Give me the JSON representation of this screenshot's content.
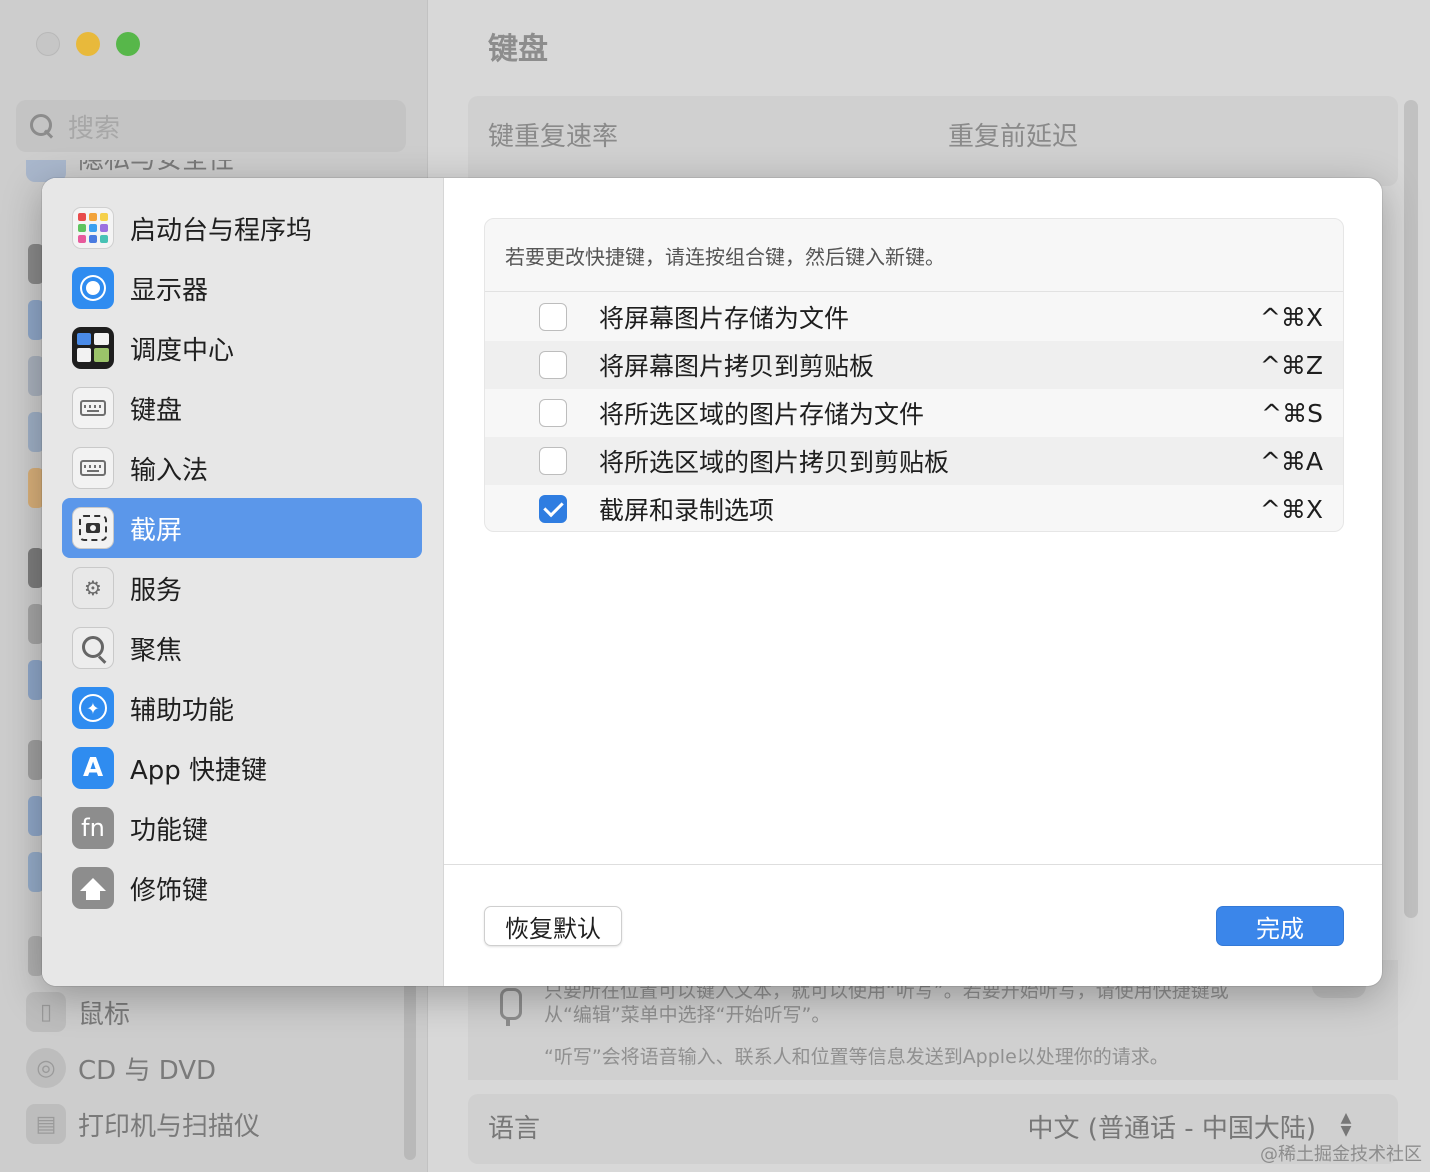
{
  "background": {
    "search_placeholder": "搜索",
    "main_title": "键盘",
    "repeat_rate_label": "键重复速率",
    "repeat_delay_label": "重复前延迟",
    "partial_sidebar_text": "隐私与安全性",
    "sidebar_items": [
      {
        "label": "鼠标",
        "icon": "mouse-icon"
      },
      {
        "label": "CD 与 DVD",
        "icon": "disc-icon"
      },
      {
        "label": "打印机与扫描仪",
        "icon": "printer-icon"
      }
    ],
    "dictation_text_line1": "只要所在位置可以键入文本，就可以使用“听写”。若要开始听写，请使用快捷键或",
    "dictation_text_line2": "从“编辑”菜单中选择“开始听写”。",
    "dictation_privacy": "“听写”会将语音输入、联系人和位置等信息发送到Apple以处理你的请求。",
    "language_label": "语言",
    "language_value": "中文 (普通话 - 中国大陆)",
    "watermark": "@稀土掘金技术社区"
  },
  "sheet": {
    "categories": [
      {
        "label": "启动台与程序坞",
        "icon": "launchpad-icon",
        "selected": false
      },
      {
        "label": "显示器",
        "icon": "display-icon",
        "selected": false
      },
      {
        "label": "调度中心",
        "icon": "mission-control-icon",
        "selected": false
      },
      {
        "label": "键盘",
        "icon": "keyboard-icon",
        "selected": false
      },
      {
        "label": "输入法",
        "icon": "input-method-icon",
        "selected": false
      },
      {
        "label": "截屏",
        "icon": "screenshot-icon",
        "selected": true
      },
      {
        "label": "服务",
        "icon": "services-icon",
        "selected": false
      },
      {
        "label": "聚焦",
        "icon": "spotlight-icon",
        "selected": false
      },
      {
        "label": "辅助功能",
        "icon": "accessibility-icon",
        "selected": false
      },
      {
        "label": "App 快捷键",
        "icon": "app-shortcuts-icon",
        "selected": false
      },
      {
        "label": "功能键",
        "icon": "function-keys-icon",
        "selected": false
      },
      {
        "label": "修饰键",
        "icon": "modifier-keys-icon",
        "selected": false
      }
    ],
    "hint": "若要更改快捷键，请连按组合键，然后键入新键。",
    "shortcuts": [
      {
        "label": "将屏幕图片存储为文件",
        "key": "^⌘X",
        "checked": false
      },
      {
        "label": "将屏幕图片拷贝到剪贴板",
        "key": "^⌘Z",
        "checked": false
      },
      {
        "label": "将所选区域的图片存储为文件",
        "key": "^⌘S",
        "checked": false
      },
      {
        "label": "将所选区域的图片拷贝到剪贴板",
        "key": "^⌘A",
        "checked": false
      },
      {
        "label": "截屏和录制选项",
        "key": "^⌘X",
        "checked": true
      }
    ],
    "restore_label": "恢复默认",
    "done_label": "完成"
  },
  "colors": {
    "accent": "#3b86ea",
    "selection": "#5b97ea",
    "checkbox_checked": "#2f7de1"
  }
}
